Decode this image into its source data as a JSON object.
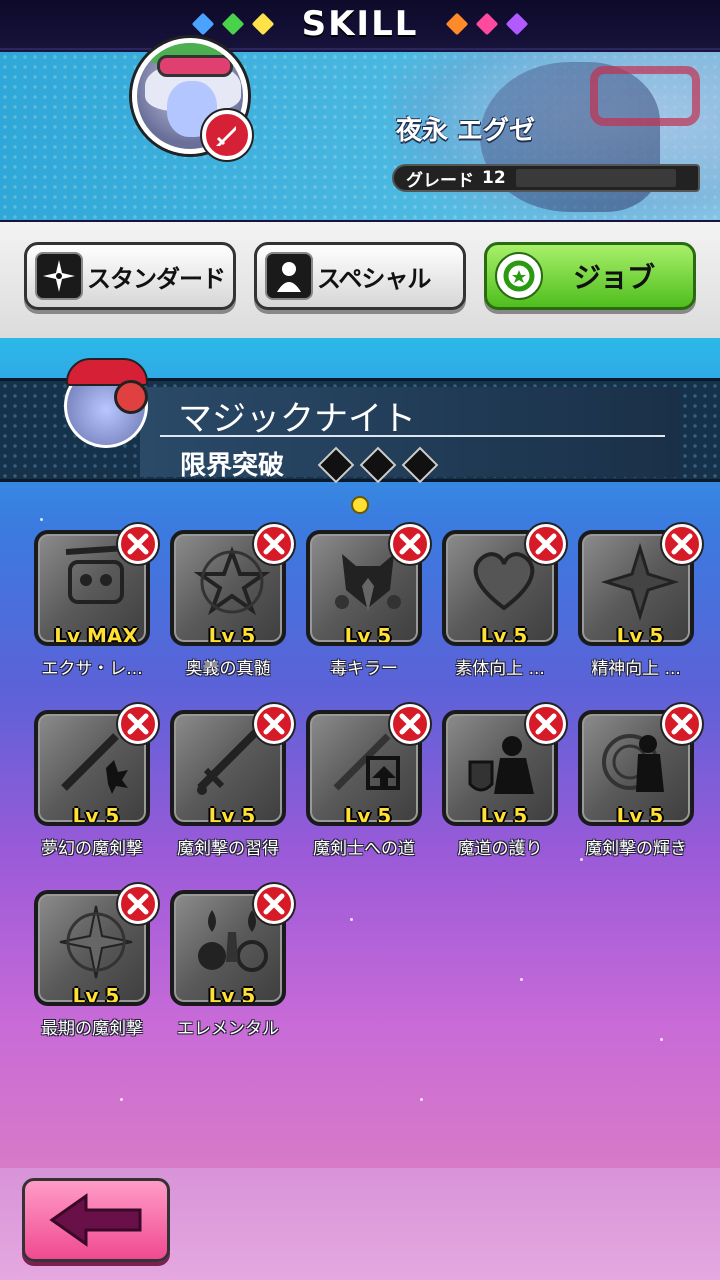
{
  "header": {
    "title": "SKILL",
    "left_gems": [
      "blue",
      "green",
      "yellow"
    ],
    "right_gems": [
      "orange",
      "pink",
      "purple"
    ]
  },
  "character": {
    "name": "夜永 エグゼ",
    "grade_label": "グレード",
    "grade_value": "12",
    "badge_icon": "sword-icon"
  },
  "tabs": [
    {
      "label": "スタンダード",
      "icon": "shuriken-icon",
      "active": false
    },
    {
      "label": "スペシャル",
      "icon": "person-icon",
      "active": false
    },
    {
      "label": "ジョブ",
      "icon": "cycle-icon",
      "active": true
    }
  ],
  "job": {
    "name": "マジックナイト",
    "limit_label": "限界突破",
    "limit_breaks_filled": 0,
    "limit_breaks_total": 3
  },
  "pager": {
    "current": 1,
    "total": 1
  },
  "skills": [
    {
      "level": "Lv MAX",
      "name": "エクサ・レ...",
      "icon": "robot-icon",
      "locked": true
    },
    {
      "level": "Lv 5",
      "name": "奥義の真髄",
      "icon": "star-ornament-icon",
      "locked": true
    },
    {
      "level": "Lv 5",
      "name": "毒キラー",
      "icon": "poison-mask-icon",
      "locked": true
    },
    {
      "level": "Lv 5",
      "name": "素体向上 ...",
      "icon": "heart-icon",
      "locked": true
    },
    {
      "level": "Lv 5",
      "name": "精神向上 ...",
      "icon": "star-icon",
      "locked": true
    },
    {
      "level": "Lv 5",
      "name": "夢幻の魔剣撃",
      "icon": "sword-burst-icon",
      "locked": true
    },
    {
      "level": "Lv 5",
      "name": "魔剣撃の習得",
      "icon": "sword-icon",
      "locked": true
    },
    {
      "level": "Lv 5",
      "name": "魔剣士への道",
      "icon": "sword-arrow-icon",
      "locked": true
    },
    {
      "level": "Lv 5",
      "name": "魔道の護り",
      "icon": "shield-knight-icon",
      "locked": true
    },
    {
      "level": "Lv 5",
      "name": "魔剣撃の輝き",
      "icon": "silhouette-spiral-icon",
      "locked": true
    },
    {
      "level": "Lv 5",
      "name": "最期の魔剣撃",
      "icon": "compass-sword-icon",
      "locked": true
    },
    {
      "level": "Lv 5",
      "name": "エレメンタル",
      "icon": "elements-icon",
      "locked": true
    }
  ],
  "footer": {
    "back_icon": "back-arrow-icon"
  },
  "colors": {
    "lock_red": "#d61a28",
    "level_yellow": "#ffe033",
    "job_tab_green": "#4fbe1e",
    "back_pink": "#f04a90"
  }
}
